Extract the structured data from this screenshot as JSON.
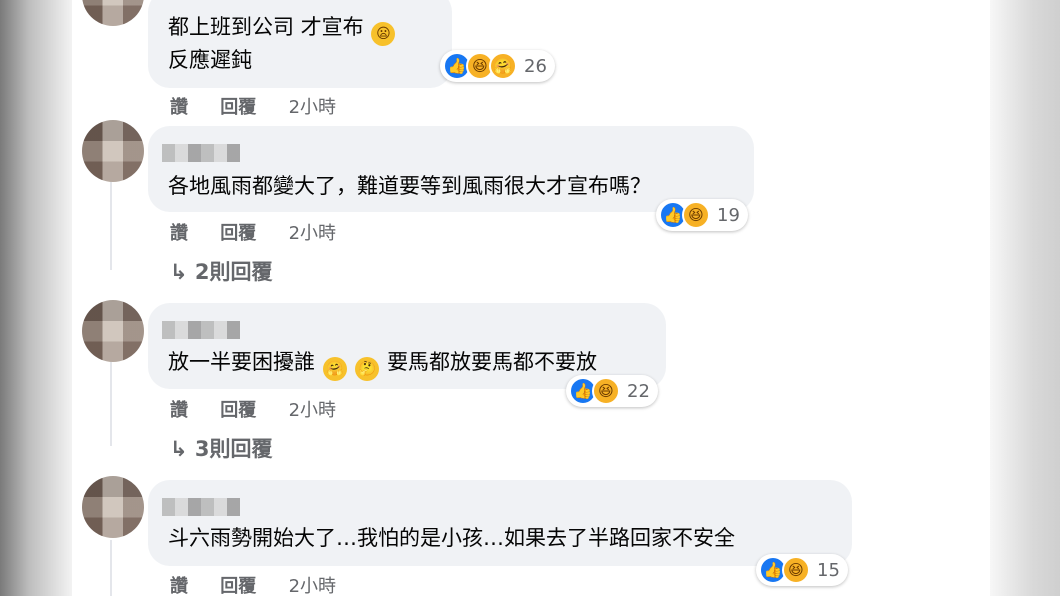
{
  "comments": [
    {
      "text_lines": [
        "都上班到公司 才宣布",
        "反應遲鈍"
      ],
      "inline_emoji": "😦",
      "reactions": [
        "like-icon",
        "haha-icon",
        "care-icon"
      ],
      "reaction_count": "26",
      "actions": {
        "like": "讚",
        "reply": "回覆",
        "time": "2小時"
      }
    },
    {
      "text": "各地風雨都變大了，難道要等到風雨很大才宣布嗎？",
      "reactions": [
        "like-icon",
        "haha-icon"
      ],
      "reaction_count": "19",
      "actions": {
        "like": "讚",
        "reply": "回覆",
        "time": "2小時"
      },
      "replies_label": "2則回覆"
    },
    {
      "text_before": "放一半要困擾誰",
      "inline_emojis": [
        "🤗",
        "🤔"
      ],
      "text_after": "要馬都放要馬都不要放",
      "reactions": [
        "like-icon",
        "haha-icon"
      ],
      "reaction_count": "22",
      "actions": {
        "like": "讚",
        "reply": "回覆",
        "time": "2小時"
      },
      "replies_label": "3則回覆"
    },
    {
      "text": "斗六雨勢開始大了…我怕的是小孩…如果去了半路回家不安全",
      "reactions": [
        "like-icon",
        "haha-icon"
      ],
      "reaction_count": "15",
      "actions": {
        "like": "讚",
        "reply": "回覆",
        "time": "2小時"
      }
    }
  ],
  "reply_arrow": "↳",
  "colors": {
    "bubble": "#f0f2f5",
    "like": "#1877f2",
    "haha": "#f7b125",
    "meta": "#65676b"
  }
}
